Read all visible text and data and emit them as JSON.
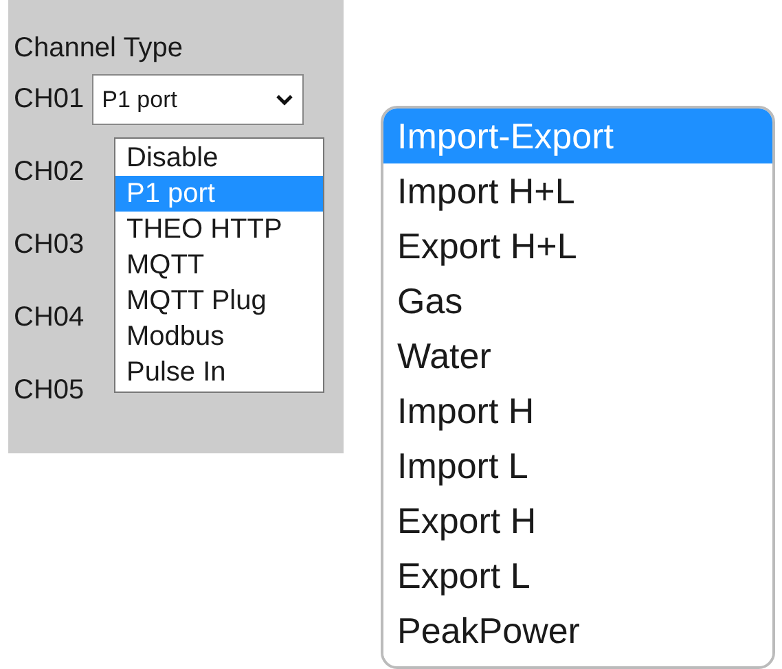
{
  "channel_panel": {
    "title": "Channel Type",
    "channels": [
      {
        "label": "CH01",
        "value": "P1 port"
      },
      {
        "label": "CH02"
      },
      {
        "label": "CH03"
      },
      {
        "label": "CH04"
      },
      {
        "label": "CH05"
      }
    ],
    "dropdown": {
      "options": [
        {
          "label": "Disable",
          "selected": false
        },
        {
          "label": "P1 port",
          "selected": true
        },
        {
          "label": "THEO HTTP",
          "selected": false
        },
        {
          "label": "MQTT",
          "selected": false
        },
        {
          "label": "MQTT Plug",
          "selected": false
        },
        {
          "label": "Modbus",
          "selected": false
        },
        {
          "label": "Pulse In",
          "selected": false
        }
      ]
    }
  },
  "meter_dropdown": {
    "options": [
      {
        "label": "Import-Export",
        "selected": true
      },
      {
        "label": "Import H+L",
        "selected": false
      },
      {
        "label": "Export H+L",
        "selected": false
      },
      {
        "label": "Gas",
        "selected": false
      },
      {
        "label": "Water",
        "selected": false
      },
      {
        "label": "Import H",
        "selected": false
      },
      {
        "label": "Import L",
        "selected": false
      },
      {
        "label": "Export H",
        "selected": false
      },
      {
        "label": "Export L",
        "selected": false
      },
      {
        "label": "PeakPower",
        "selected": false
      }
    ]
  }
}
